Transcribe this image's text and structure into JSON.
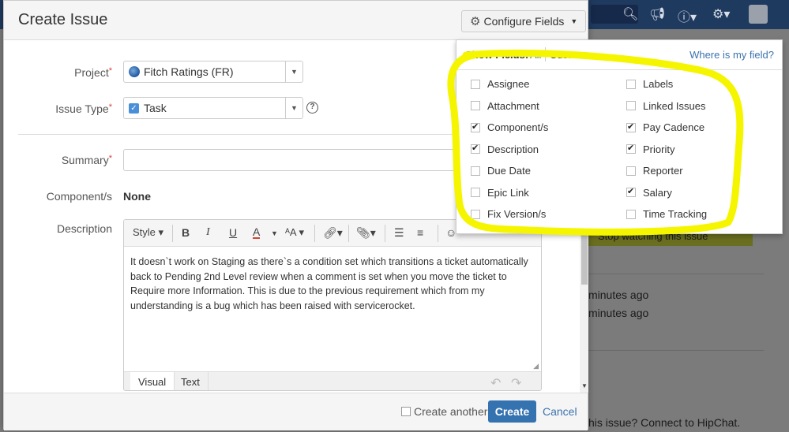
{
  "background": {
    "header_icons": [
      "search-icon",
      "megaphone-icon",
      "help-icon",
      "gear-icon",
      "avatar"
    ],
    "text": {
      "watch": "Stop watching this issue",
      "time_1": "minutes ago",
      "time_2": "minutes ago",
      "hipchat": "his issue? Connect to HipChat."
    },
    "colors": {
      "header": "#1f3a5f"
    }
  },
  "dialog": {
    "title": "Create Issue",
    "configure_fields_label": "Configure Fields",
    "fields": {
      "project_label": "Project",
      "project_value": "Fitch Ratings (FR)",
      "issue_type_label": "Issue Type",
      "issue_type_value": "Task",
      "summary_label": "Summary",
      "summary_value": "",
      "components_label": "Component/s",
      "components_value": "None",
      "description_label": "Description",
      "description_value": "It doesn`t work on Staging as there`s a condition set which transitions a ticket automatically back to Pending 2nd Level review when a comment is set when you move the ticket to Require more Information. This is due to the previous requirement which from my understanding is a bug which has been raised with servicerocket."
    },
    "required_mark": "*",
    "editor": {
      "style_label": "Style",
      "bold": "B",
      "italic": "I",
      "underline": "U",
      "text_color": "A",
      "text_size": "ᴬA",
      "tabs": [
        "Visual",
        "Text"
      ]
    },
    "footer": {
      "create_another_label": "Create another",
      "create_another_checked": false,
      "create_label": "Create",
      "cancel_label": "Cancel"
    },
    "colors": {
      "primary_button": "#3572b0",
      "link": "#3b73af",
      "required": "#d04437"
    }
  },
  "configure_panel": {
    "show_fields_label": "Show Fields:",
    "all_label": "All",
    "custom_label": "Custom",
    "where_label": "Where is my field?",
    "left_column": [
      {
        "label": "Assignee",
        "checked": false
      },
      {
        "label": "Attachment",
        "checked": false
      },
      {
        "label": "Component/s",
        "checked": true
      },
      {
        "label": "Description",
        "checked": true
      },
      {
        "label": "Due Date",
        "checked": false
      },
      {
        "label": "Epic Link",
        "checked": false
      },
      {
        "label": "Fix Version/s",
        "checked": false
      }
    ],
    "right_column": [
      {
        "label": "Labels",
        "checked": false
      },
      {
        "label": "Linked Issues",
        "checked": false
      },
      {
        "label": "Pay Cadence",
        "checked": true
      },
      {
        "label": "Priority",
        "checked": true
      },
      {
        "label": "Reporter",
        "checked": false
      },
      {
        "label": "Salary",
        "checked": true
      },
      {
        "label": "Time Tracking",
        "checked": false
      }
    ],
    "highlight_color": "#f5f500"
  }
}
